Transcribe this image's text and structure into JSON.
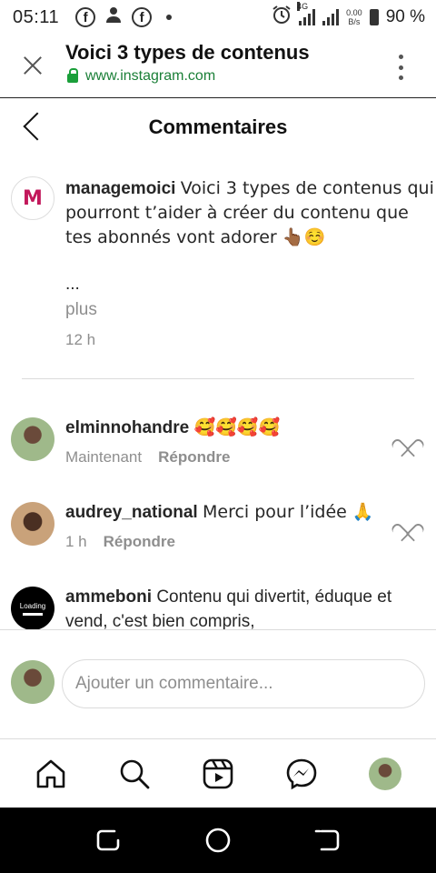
{
  "status_bar": {
    "time": "05:11",
    "network_type": "4G",
    "net_speed_value": "0.00",
    "net_speed_unit": "B/s",
    "battery": "90 %",
    "icons": [
      "facebook-icon",
      "person-sync-icon",
      "facebook-icon",
      "dot-icon",
      "alarm-icon",
      "signal-icon",
      "signal-icon",
      "battery-icon"
    ]
  },
  "browser": {
    "title": "Voici 3 types de contenus",
    "url": "www.instagram.com"
  },
  "header": {
    "title": "Commentaires"
  },
  "caption": {
    "avatar_text": "M",
    "username": "managemoici",
    "text": "Voici 3 types de contenus qui pourront t’aider à créer du contenu que tes abonnés vont adorer 👆🏾☺️",
    "ellipsis": "...",
    "more": "plus",
    "time": "12 h"
  },
  "comments": [
    {
      "username": "elminnohandre",
      "text": "🥰🥰🥰🥰",
      "time": "Maintenant",
      "reply": "Répondre"
    },
    {
      "username": "audrey_national",
      "text": "Merci pour l’idée 🙏",
      "time": "1 h",
      "reply": "Répondre"
    },
    {
      "username": "ammeboni",
      "text": "Contenu qui divertit, éduque et vend, c'est bien compris,",
      "time": "",
      "reply": "",
      "avatar_text": "Loading"
    }
  ],
  "add_comment": {
    "placeholder": "Ajouter un commentaire..."
  },
  "colors": {
    "text": "#262626",
    "secondary": "#8e8e8e",
    "url_green": "#1a7f37",
    "divider": "#dbdbdb"
  }
}
